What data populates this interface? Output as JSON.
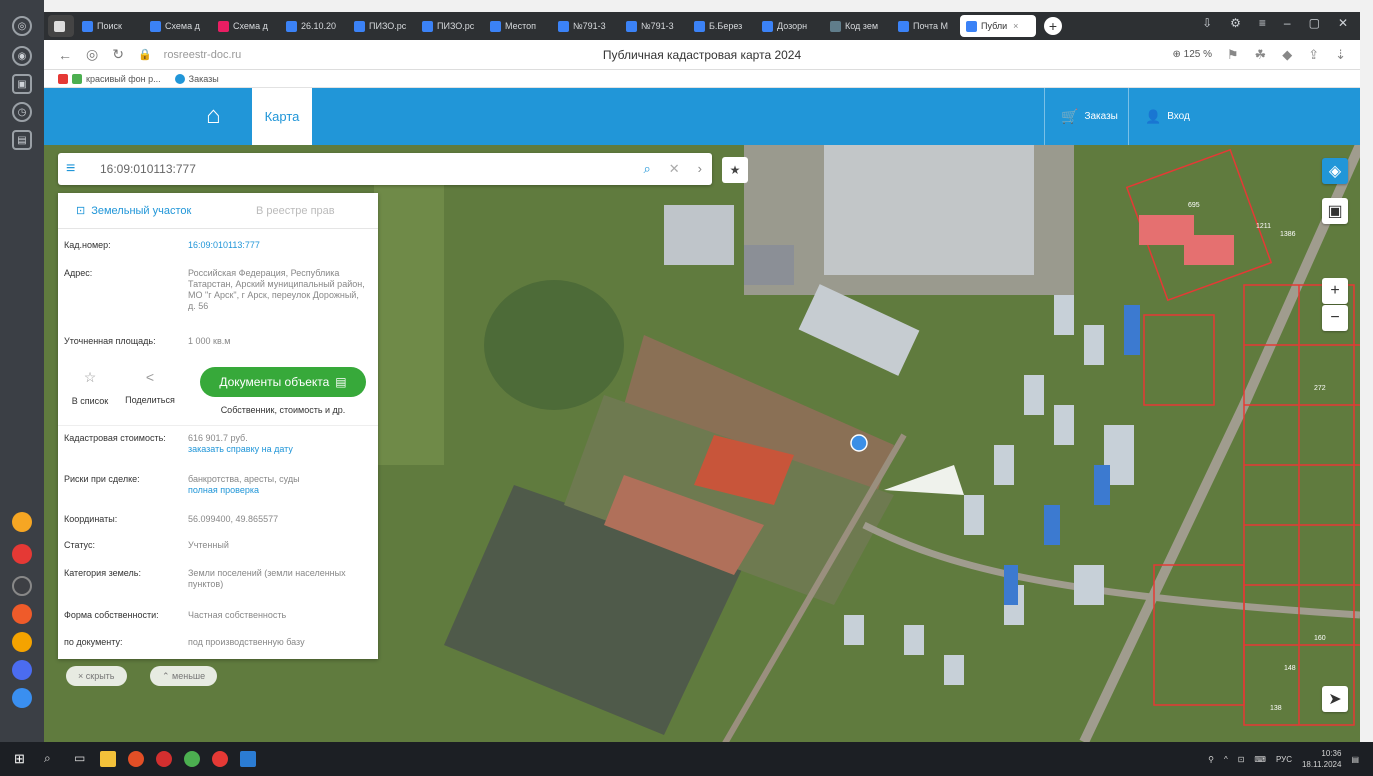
{
  "browser": {
    "tabs": [
      {
        "label": "Поиск"
      },
      {
        "label": "Схема д"
      },
      {
        "label": "Схема д"
      },
      {
        "label": "26.10.20"
      },
      {
        "label": "ПИЗО.рс"
      },
      {
        "label": "ПИЗО.рс"
      },
      {
        "label": "Местоп"
      },
      {
        "label": "№791-3"
      },
      {
        "label": "№791-3"
      },
      {
        "label": "Б.Берез"
      },
      {
        "label": "Дозорн"
      },
      {
        "label": "Код зем"
      },
      {
        "label": "Почта М"
      },
      {
        "label": "Публи"
      }
    ],
    "url": "rosreestr-doc.ru",
    "page_title": "Публичная кадастровая карта 2024",
    "zoom": "125 %",
    "bookmarks": [
      "красивый фон р...",
      "Заказы"
    ]
  },
  "header": {
    "map_tab": "Карта",
    "orders": "Заказы",
    "login": "Вход"
  },
  "search": {
    "query": "16:09:010113:777"
  },
  "panel": {
    "tab_active": "Земельный участок",
    "tab_other": "В реестре прав",
    "fields": {
      "cad_label": "Кад.номер:",
      "cad_value": "16:09:010113:777",
      "addr_label": "Адрес:",
      "addr_value": "Российская Федерация, Республика Татарстан, Арский муниципальный район, МО \"г Арск\", г Арск, переулок Дорожный, д. 56",
      "area_label": "Уточненная площадь:",
      "area_value": "1 000 кв.м",
      "cost_label": "Кадастровая стоимость:",
      "cost_value": "616 901.7 руб.",
      "cost_link": "заказать справку на дату",
      "risk_label": "Риски при сделке:",
      "risk_value": "банкротства, аресты, суды",
      "risk_link": "полная проверка",
      "coord_label": "Координаты:",
      "coord_value": "56.099400, 49.865577",
      "status_label": "Статус:",
      "status_value": "Учтенный",
      "cat_label": "Категория земель:",
      "cat_value": "Земли поселений (земли населенных пунктов)",
      "own_label": "Форма собственности:",
      "own_value": "Частная собственность",
      "doc_label": "по документу:",
      "doc_value": "под производственную базу"
    },
    "actions": {
      "list": "В список",
      "share": "Поделиться",
      "docs_button": "Документы объекта",
      "docs_caption": "Собственник, стоимость и др."
    },
    "pill_hide": "скрыть",
    "pill_less": "меньше"
  },
  "map": {
    "plots": [
      "695",
      "1211",
      "1386",
      "272",
      "160",
      "148",
      "138"
    ]
  },
  "taskbar": {
    "lang": "РУС",
    "time": "10:36",
    "date": "18.11.2024"
  },
  "colors": {
    "accent": "#2196d8",
    "doc_button": "#37a93a"
  }
}
